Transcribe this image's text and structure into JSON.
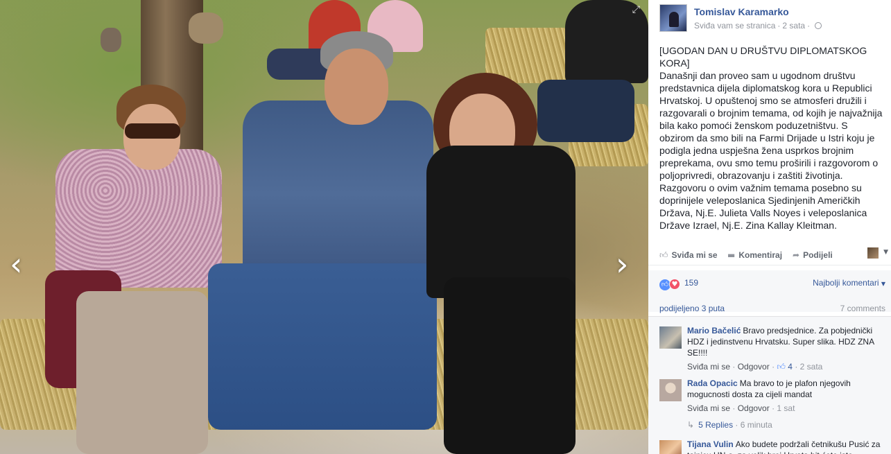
{
  "photo": {
    "prev_icon": "‹",
    "next_icon": "›",
    "expand_icon": "⤢"
  },
  "post": {
    "author": "Tomislav Karamarko",
    "meta_like": "Sviđa vam se stranica",
    "meta_time": "2 sata",
    "text": "[UGODAN DAN U DRUŠTVU DIPLOMATSKOG KORA]\nDanašnji dan proveo sam u ugodnom društvu predstavnica dijela diplomatskog kora u Republici Hrvatskoj. U opuštenoj smo se atmosferi družili i razgovarali o brojnim temama, od kojih je najvažnija bila kako pomoći ženskom poduzetništvu. S obzirom da smo bili na Farmi Drijade u Istri koju je podigla jedna uspješna žena usprkos brojnim preprekama, ovu smo temu proširili i razgovorom o poljoprivredi, obrazovanju i zaštiti životinja.\nRazgovoru o ovim važnim temama posebno su doprinijele veleposlanica Sjedinjenih Američkih Država, Nj.E. Julieta Valls Noyes i veleposlanica Države Izrael, Nj.E. Zina Kallay Kleitman."
  },
  "actions": {
    "like": "Sviđa mi se",
    "comment": "Komentiraj",
    "share": "Podijeli",
    "caret": "▼"
  },
  "reactions": {
    "count": "159",
    "sort": "Najbolji komentari",
    "shares": "podijeljeno 3 puta",
    "comments_count": "7 comments"
  },
  "comments": [
    {
      "name": "Mario Bačelić",
      "text": "Bravo predsjednice. Za pobjednički HDZ i jedinstvenu Hrvatsku. Super slika. HDZ ZNA SE!!!!",
      "like": "Sviđa mi se",
      "reply": "Odgovor",
      "likes": "4",
      "time": "2 sata"
    },
    {
      "name": "Rada Opacic",
      "text": "Ma bravo to je plafon njegovih mogucnosti dosta za cijeli mandat",
      "like": "Sviđa mi se",
      "reply": "Odgovor",
      "time": "1 sat",
      "replies": "5 Replies",
      "replies_time": "6 minuta"
    },
    {
      "name": "Tijana Vulin",
      "text": "Ako budete podržali četnikušu Pusić za tajnicu UN-a, za velik broj Hrvata bit ćete isto"
    }
  ],
  "colors": {
    "link": "#365899",
    "muted": "#90949c",
    "like_blue": "#5890ff",
    "love_red": "#f25268"
  }
}
